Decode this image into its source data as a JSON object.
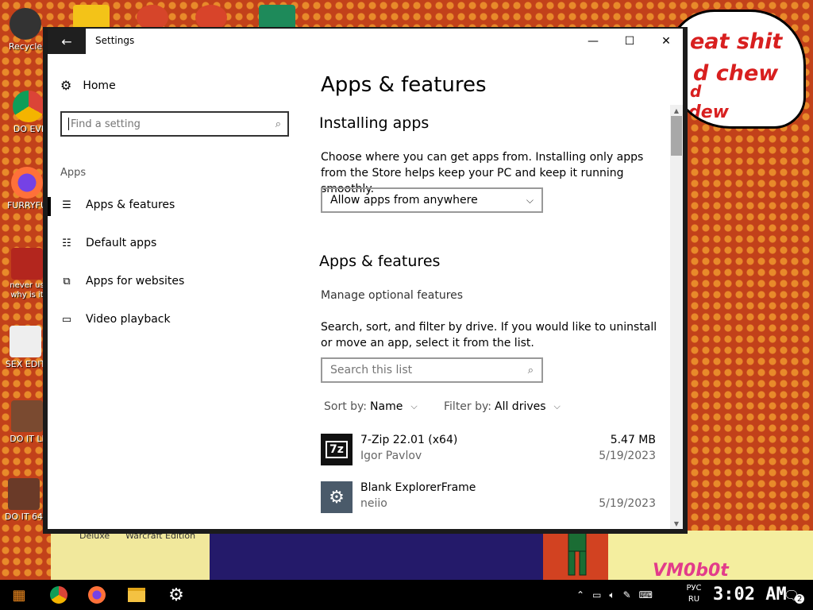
{
  "desktop": {
    "icons": [
      {
        "label": "Recycle"
      },
      {
        "label": "DO EVI"
      },
      {
        "label": "FURRYFU"
      },
      {
        "label": "never us why is it"
      },
      {
        "label": "SEX EDIT"
      },
      {
        "label": "DO IT LI"
      },
      {
        "label": "DO IT 64"
      }
    ],
    "bubble_lines": [
      "eat shit",
      "d chew",
      "d",
      "dew"
    ],
    "strip_labels": [
      "Deluxe",
      "Warcraft Edition"
    ],
    "watermark": "VM0b0t"
  },
  "window": {
    "title": "Settings",
    "back_icon": "back-arrow-icon",
    "controls": {
      "minimize": "—",
      "maximize": "☐",
      "close": "✕"
    }
  },
  "nav": {
    "home_label": "Home",
    "search_placeholder": "Find a setting",
    "section_label": "Apps",
    "items": [
      {
        "label": "Apps & features",
        "icon": "list-icon",
        "active": true
      },
      {
        "label": "Default apps",
        "icon": "default-apps-icon"
      },
      {
        "label": "Apps for websites",
        "icon": "open-link-icon"
      },
      {
        "label": "Video playback",
        "icon": "video-icon"
      }
    ]
  },
  "main": {
    "title": "Apps & features",
    "installing": {
      "heading": "Installing apps",
      "description": "Choose where you can get apps from. Installing only apps from the Store helps keep your PC and keep it running smoothly.",
      "dropdown_value": "Allow apps from anywhere"
    },
    "apps": {
      "heading": "Apps & features",
      "manage_link": "Manage optional features",
      "description": "Search, sort, and filter by drive. If you would like to uninstall or move an app, select it from the list.",
      "search_placeholder": "Search this list",
      "sort_label": "Sort by:",
      "sort_value": "Name",
      "filter_label": "Filter by:",
      "filter_value": "All drives",
      "list": [
        {
          "name": "7-Zip 22.01 (x64)",
          "publisher": "Igor Pavlov",
          "size": "5.47 MB",
          "date": "5/19/2023",
          "icon_text": "7z"
        },
        {
          "name": "Blank ExplorerFrame",
          "publisher": "neiio",
          "size": "",
          "date": "5/19/2023",
          "icon_text": "⚙"
        }
      ]
    }
  },
  "taskbar": {
    "lang_top": "РУС",
    "lang_bottom": "RU",
    "clock": "3:02 AM",
    "notifications": "2"
  }
}
